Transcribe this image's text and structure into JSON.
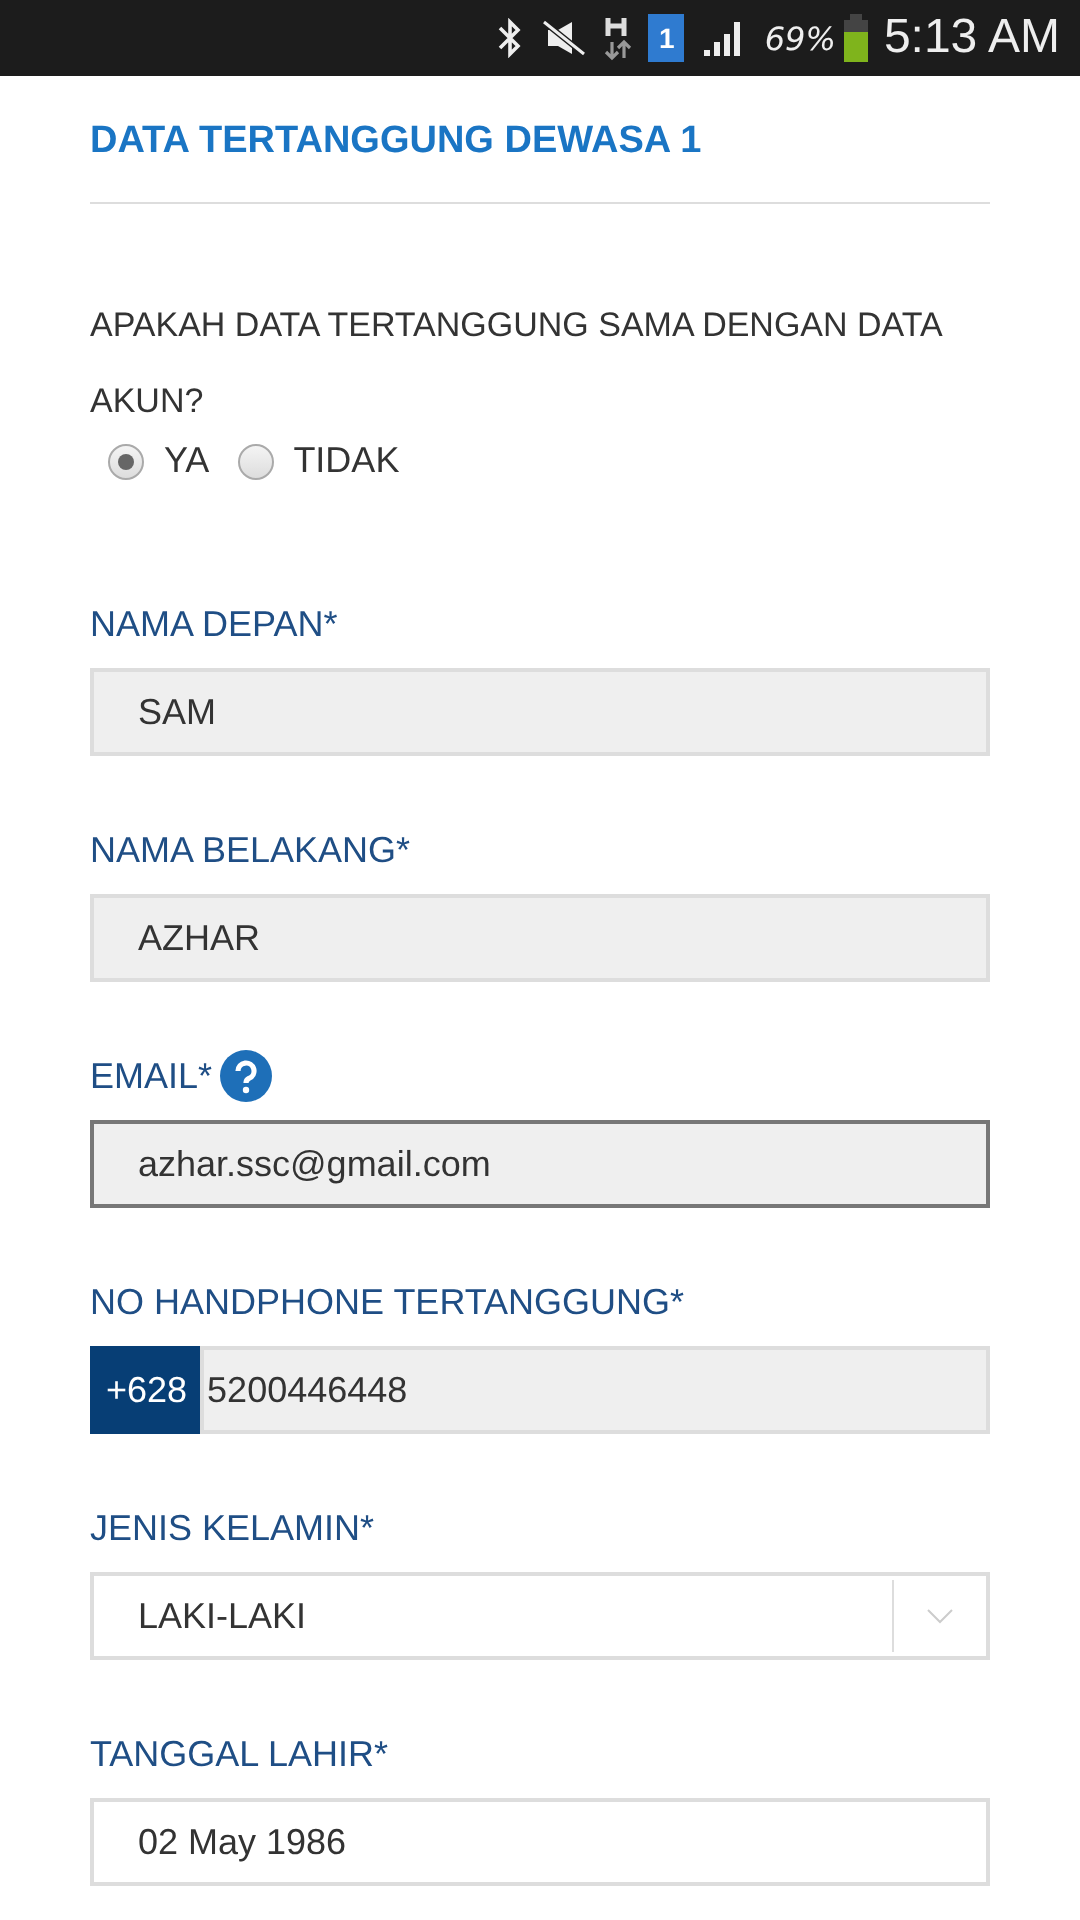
{
  "status_bar": {
    "sim": "1",
    "battery_text": "69%",
    "time": "5:13 AM"
  },
  "section_title": "DATA TERTANGGUNG DEWASA 1",
  "question": {
    "text": "APAKAH DATA TERTANGGUNG SAMA DENGAN DATA AKUN?",
    "options": [
      {
        "label": "YA",
        "selected": true
      },
      {
        "label": "TIDAK",
        "selected": false
      }
    ]
  },
  "fields": [
    {
      "kind": "text",
      "label": "NAMA DEPAN*",
      "value": "SAM",
      "disabled": true,
      "focused": false,
      "help": false
    },
    {
      "kind": "text",
      "label": "NAMA BELAKANG*",
      "value": "AZHAR",
      "disabled": true,
      "focused": false,
      "help": false
    },
    {
      "kind": "text",
      "label": "EMAIL*",
      "value": "azhar.ssc@gmail.com",
      "disabled": true,
      "focused": true,
      "help": true
    },
    {
      "kind": "phone",
      "label": "NO HANDPHONE TERTANGGUNG*",
      "prefix": "+628",
      "value": "5200446448",
      "disabled": true,
      "focused": false,
      "help": false
    },
    {
      "kind": "select",
      "label": "JENIS KELAMIN*",
      "value": "LAKI-LAKI",
      "disabled": false,
      "focused": false,
      "help": false
    },
    {
      "kind": "text",
      "label": "TANGGAL LAHIR*",
      "value": "02 May 1986",
      "disabled": false,
      "focused": false,
      "help": false
    }
  ]
}
